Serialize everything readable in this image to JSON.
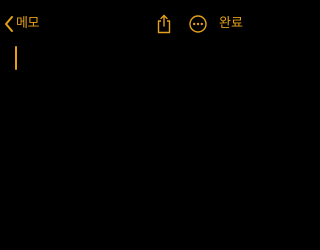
{
  "nav": {
    "back_label": "메모",
    "back_icon": "chevron-left-icon",
    "share_icon": "share-icon",
    "more_icon": "ellipsis-circle-icon",
    "done_label": "완료"
  },
  "editor": {
    "content": ""
  },
  "colors": {
    "accent": "#e5a01a",
    "background": "#000000"
  }
}
